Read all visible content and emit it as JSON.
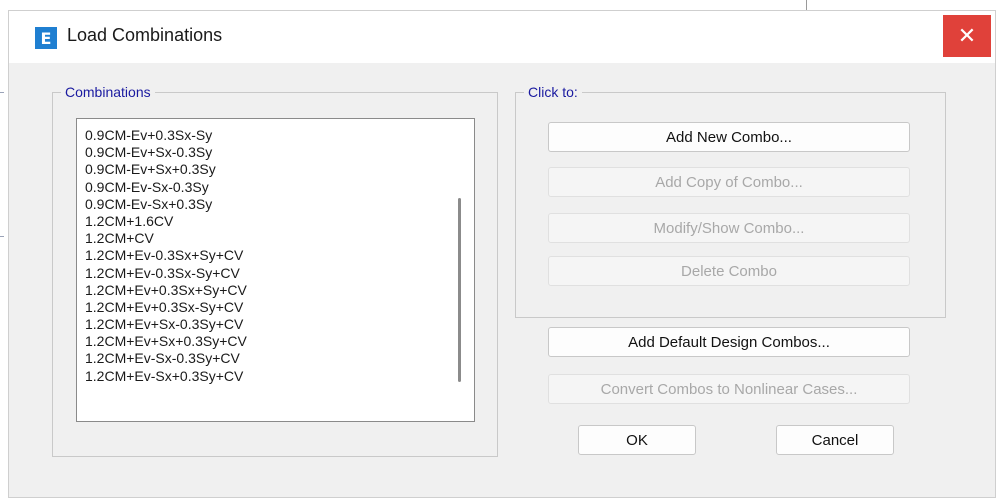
{
  "window": {
    "title": "Load Combinations",
    "app_icon_letter": "E",
    "close_glyph": "✕"
  },
  "combinations": {
    "legend": "Combinations",
    "items": [
      "0.9CM-Ev+0.3Sx-Sy",
      "0.9CM-Ev+Sx-0.3Sy",
      "0.9CM-Ev+Sx+0.3Sy",
      "0.9CM-Ev-Sx-0.3Sy",
      "0.9CM-Ev-Sx+0.3Sy",
      "1.2CM+1.6CV",
      "1.2CM+CV",
      "1.2CM+Ev-0.3Sx+Sy+CV",
      "1.2CM+Ev-0.3Sx-Sy+CV",
      "1.2CM+Ev+0.3Sx+Sy+CV",
      "1.2CM+Ev+0.3Sx-Sy+CV",
      "1.2CM+Ev+Sx-0.3Sy+CV",
      "1.2CM+Ev+Sx+0.3Sy+CV",
      "1.2CM+Ev-Sx-0.3Sy+CV",
      "1.2CM+Ev-Sx+0.3Sy+CV"
    ]
  },
  "click_to": {
    "legend": "Click to:",
    "add_new": "Add New Combo...",
    "add_copy": "Add Copy of Combo...",
    "modify_show": "Modify/Show Combo...",
    "delete": "Delete Combo"
  },
  "add_default": "Add Default Design Combos...",
  "convert": "Convert Combos to Nonlinear Cases...",
  "ok": "OK",
  "cancel": "Cancel"
}
